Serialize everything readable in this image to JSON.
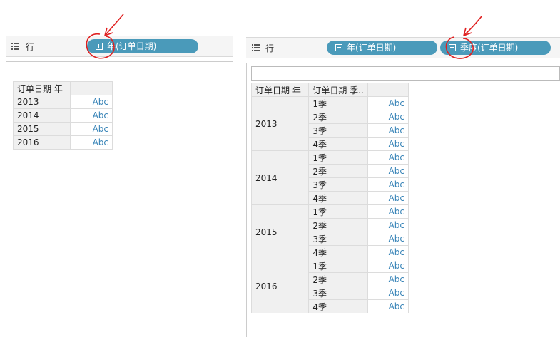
{
  "left": {
    "shelf_label": "行",
    "pill": "年(订单日期)",
    "header": "订单日期 年",
    "rows": [
      {
        "year": "2013",
        "value": "Abc"
      },
      {
        "year": "2014",
        "value": "Abc"
      },
      {
        "year": "2015",
        "value": "Abc"
      },
      {
        "year": "2016",
        "value": "Abc"
      }
    ]
  },
  "right": {
    "shelf_label": "行",
    "pills": [
      "年(订单日期)",
      "季度(订单日期)"
    ],
    "headers": [
      "订单日期 年",
      "订单日期 季.."
    ],
    "groups": [
      {
        "year": "2013",
        "quarters": [
          "1季",
          "2季",
          "3季",
          "4季"
        ],
        "value": "Abc"
      },
      {
        "year": "2014",
        "quarters": [
          "1季",
          "2季",
          "3季",
          "4季"
        ],
        "value": "Abc"
      },
      {
        "year": "2015",
        "quarters": [
          "1季",
          "2季",
          "3季",
          "4季"
        ],
        "value": "Abc"
      },
      {
        "year": "2016",
        "quarters": [
          "1季",
          "2季",
          "3季",
          "4季"
        ],
        "value": "Abc"
      }
    ]
  },
  "colors": {
    "pill": "#4a9aba",
    "annotation": "#e02020",
    "abc_text": "#3a85b8",
    "header_bg": "#f0f0f0"
  }
}
